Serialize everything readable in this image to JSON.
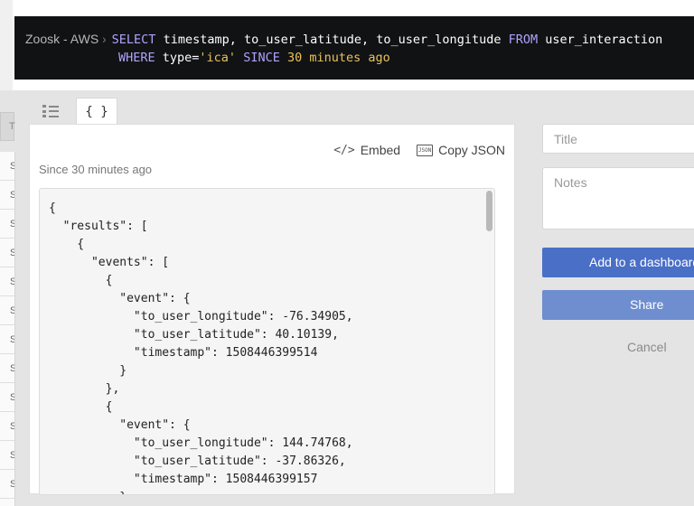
{
  "query": {
    "account": "Zoosk - AWS",
    "line1": [
      {
        "t": "SELECT",
        "c": "kw"
      },
      {
        "t": " timestamp, to_user_latitude, to_user_longitude ",
        "c": ""
      },
      {
        "t": "FROM",
        "c": "kw"
      },
      {
        "t": " user_interaction",
        "c": ""
      }
    ],
    "line2": [
      {
        "t": "WHERE",
        "c": "kw"
      },
      {
        "t": " type=",
        "c": ""
      },
      {
        "t": "'ica'",
        "c": "str"
      },
      {
        "t": " ",
        "c": ""
      },
      {
        "t": "SINCE",
        "c": "kw"
      },
      {
        "t": " ",
        "c": ""
      },
      {
        "t": "30",
        "c": "num"
      },
      {
        "t": " ",
        "c": ""
      },
      {
        "t": "minutes ago",
        "c": "str"
      }
    ]
  },
  "tabs": {
    "list_icon": "list-icon",
    "json_label": "{ }"
  },
  "panel": {
    "embed_label": "Embed",
    "copy_json_label": "Copy JSON",
    "since_text": "Since 30 minutes ago"
  },
  "json_text": "{\n  \"results\": [\n    {\n      \"events\": [\n        {\n          \"event\": {\n            \"to_user_longitude\": -76.34905,\n            \"to_user_latitude\": 40.10139,\n            \"timestamp\": 1508446399514\n          }\n        },\n        {\n          \"event\": {\n            \"to_user_longitude\": 144.74768,\n            \"to_user_latitude\": -37.86326,\n            \"timestamp\": 1508446399157\n          }\n        },",
  "form": {
    "title_placeholder": "Title",
    "notes_placeholder": "Notes",
    "add_label": "Add to a dashboard",
    "share_label": "Share",
    "cancel_label": "Cancel"
  },
  "bg_list": {
    "tab_letter": "T",
    "rows": [
      "S",
      "S",
      "S",
      "S",
      "S",
      "S",
      "S",
      "S",
      "S",
      "S",
      "S",
      "S"
    ]
  },
  "colors": {
    "query_bg": "#111214",
    "keyword": "#b0a2ff",
    "string": "#e8c35a",
    "primary_button": "#4a6fc7",
    "share_button": "#6f8ecf"
  }
}
